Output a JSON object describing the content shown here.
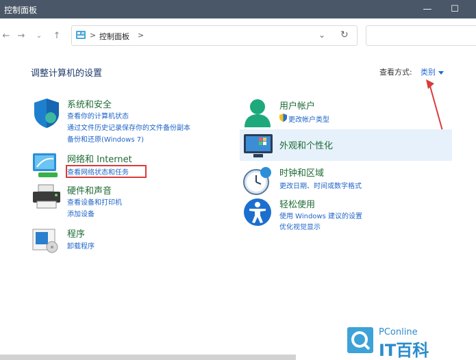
{
  "window": {
    "title": "控制面板",
    "minimize_icon": "minimize-icon",
    "maximize_icon": "maximize-icon"
  },
  "nav": {
    "back_icon": "arrow-left-icon",
    "forward_icon": "arrow-right-icon",
    "recent_icon": "chevron-down-icon",
    "up_icon": "arrow-up-icon"
  },
  "address": {
    "crumb": "控制面板",
    "separator": ">",
    "dropdown_icon": "chevron-down-icon",
    "refresh_icon": "refresh-icon"
  },
  "search": {
    "placeholder": ""
  },
  "header": {
    "heading": "调整计算机的设置",
    "view_by_label": "查看方式:",
    "view_by_value": "类别"
  },
  "categories_left": [
    {
      "title": "系统和安全",
      "icon": "shield-icon",
      "links": [
        "查看你的计算机状态",
        "通过文件历史记录保存你的文件备份副本",
        "备份和还原(Windows 7)"
      ]
    },
    {
      "title": "网络和 Internet",
      "icon": "network-icon",
      "links": [
        "查看网络状态和任务"
      ]
    },
    {
      "title": "硬件和声音",
      "icon": "printer-icon",
      "links": [
        "查看设备和打印机",
        "添加设备"
      ]
    },
    {
      "title": "程序",
      "icon": "programs-icon",
      "links": [
        "卸载程序"
      ]
    }
  ],
  "categories_right": [
    {
      "title": "用户帐户",
      "icon": "user-icon",
      "links": [
        "更改帐户类型"
      ]
    },
    {
      "title": "外观和个性化",
      "icon": "monitor-icon",
      "links": []
    },
    {
      "title": "时钟和区域",
      "icon": "clock-icon",
      "links": [
        "更改日期、时间或数字格式"
      ]
    },
    {
      "title": "轻松使用",
      "icon": "accessibility-icon",
      "links": [
        "使用 Windows 建议的设置",
        "优化视觉显示"
      ]
    }
  ],
  "watermark": {
    "small": "PConline",
    "big": "IT百科"
  },
  "colors": {
    "titlebar": "#4a5768",
    "category_title": "#1e6a34",
    "link": "#1e64c8",
    "annotation": "#d93a3a",
    "highlight": "#e6f1fb"
  }
}
